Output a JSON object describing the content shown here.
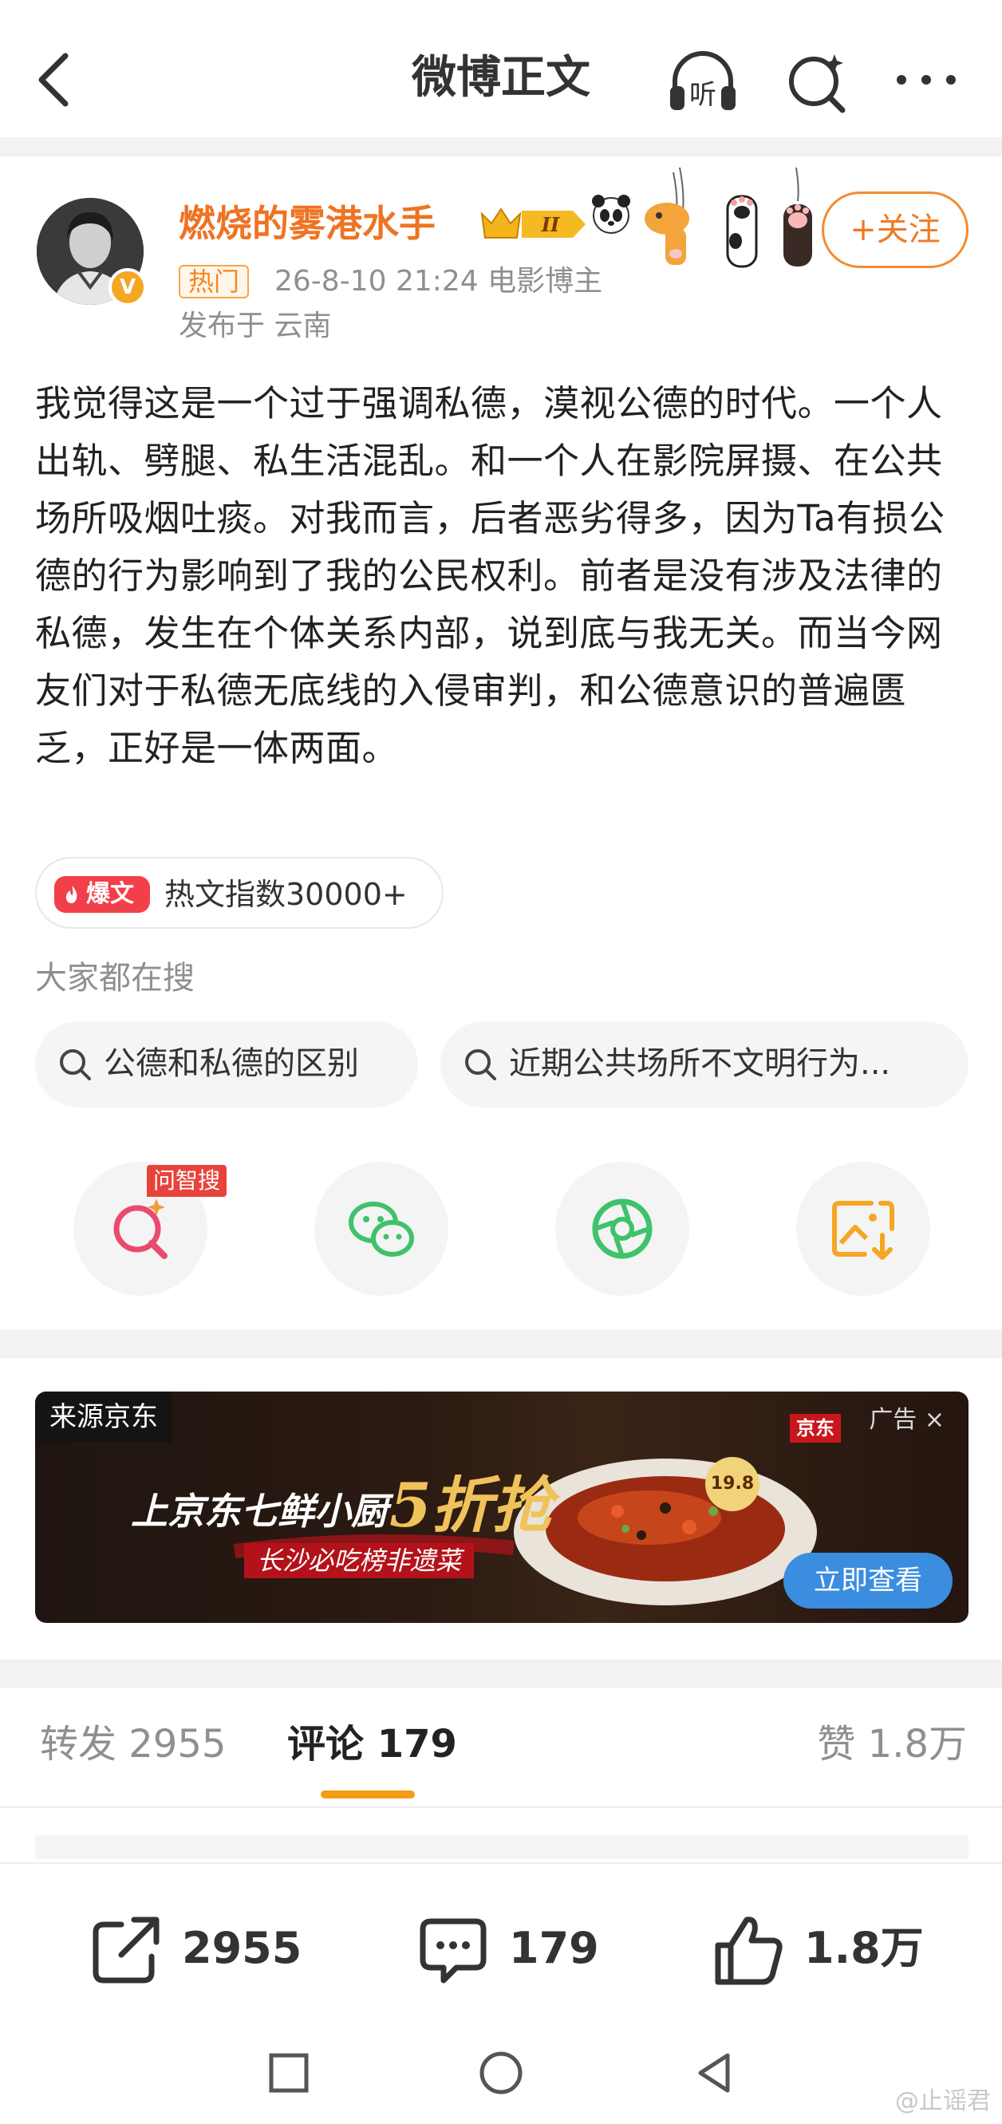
{
  "header": {
    "title": "微博正文",
    "listen_icon_text": "听"
  },
  "post": {
    "author": {
      "name": "燃烧的雾港水手",
      "avatar_badge": "V",
      "level_badge": "II"
    },
    "follow_label": "+关注",
    "hot_tag": "热门",
    "meta": "26-8-10 21:24  电影博主",
    "location": "发布于 云南",
    "text": "我觉得这是一个过于强调私德，漠视公德的时代。一个人出轨、劈腿、私生活混乱。和一个人在影院屏摄、在公共场所吸烟吐痰。对我而言，后者恶劣得多，因为Ta有损公德的行为影响到了我的公民权利。前者是没有涉及法律的私德，发生在个体关系内部，说到底与我无关。而当今网友们对于私德无底线的入侵审判，和公德意识的普遍匮乏，正好是一体两面。",
    "hot_index": {
      "badge": "爆文",
      "text": "热文指数30000+"
    }
  },
  "search_suggest": {
    "title": "大家都在搜",
    "chips": [
      "公德和私德的区别",
      "近期公共场所不文明行为..."
    ]
  },
  "share": {
    "wenzhisou_badge": "问智搜",
    "items": [
      "wenzhisou-icon",
      "wechat-icon",
      "moments-icon",
      "save-image-icon"
    ]
  },
  "ad": {
    "source": "来源京东",
    "label": "广告 ×",
    "headline": "上京东七鲜小厨",
    "discount": "5折抢",
    "sub": "长沙必吃榜非遗菜",
    "price": "19.8",
    "brand": "京东",
    "cta": "立即查看"
  },
  "tabs": {
    "repost": "转发 2955",
    "comment": "评论 179",
    "like": "赞 1.8万"
  },
  "actions": {
    "repost": "2955",
    "comment": "179",
    "like": "1.8万"
  },
  "watermark": "@止谣君",
  "colors": {
    "accent_orange": "#f07a24",
    "name_orange": "#ee7322",
    "tab_underline": "#f59b16",
    "hot_red": "#f2404a",
    "wechat_green": "#3fc26a",
    "cta_blue": "#3b8de0"
  }
}
